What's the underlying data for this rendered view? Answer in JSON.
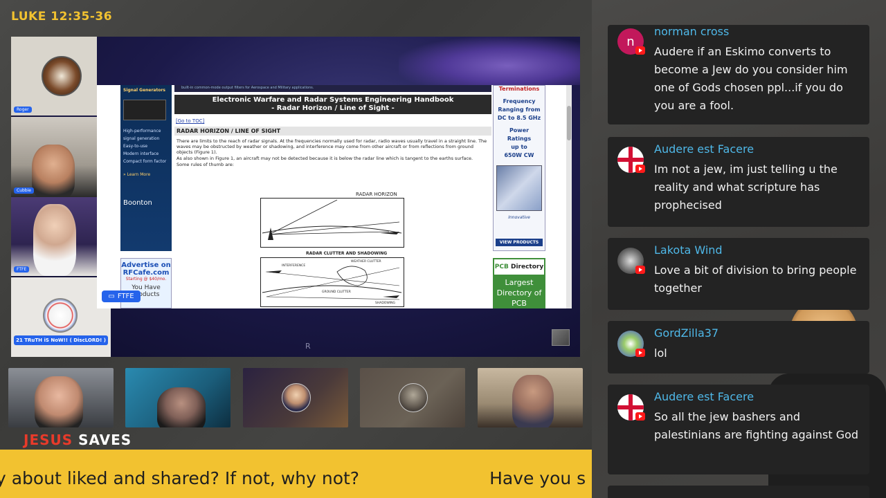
{
  "header": {
    "verse": "LUKE 12:35-36"
  },
  "stage": {
    "cameras": [
      {
        "label": "Roger"
      },
      {
        "label": "Cubbie"
      },
      {
        "label": "FTFE"
      },
      {
        "label": "21 TRuTH iS NoW!! ( DiscLORD! )"
      }
    ],
    "ftfe_chip": "FTFE",
    "watermark": "R",
    "webpage": {
      "top_strip": "built-in common-mode output filters for Aerospace and Military applications.",
      "left_ad_heading": "Signal Generators",
      "left_ad_features": [
        "High-performance signal generation",
        "Easy-to-use",
        "Modern interface",
        "Compact form factor"
      ],
      "left_ad_link": "» Learn More",
      "left_ad_brand": "Boonton",
      "title_line1": "Electronic Warfare and Radar Systems Engineering Handbook",
      "title_line2": "- Radar Horizon / Line of Sight -",
      "toc_link": "[Go to TOC]",
      "section_heading": "RADAR HORIZON / LINE OF SIGHT",
      "paragraph1": "There are limits to the reach of radar signals. At the frequencies normally used for radar, radio waves usually travel in a straight line. The waves may be obstructed by weather or shadowing, and interference may come from other aircraft or from reflections from ground objects (Figure 1).",
      "paragraph2": "As also shown in Figure 1, an aircraft may not be detected because it is below the radar line which is tangent to the earths surface.",
      "paragraph3": "Some rules of thumb are:",
      "figure1_title": "RADAR HORIZON",
      "figure2_title": "RADAR CLUTTER AND SHADOWING",
      "figure2_labels": [
        "INTERFERENCE",
        "WEATHER CLUTTER",
        "GROUND CLUTTER",
        "SHADOWING"
      ],
      "rfcafe_ad": [
        "Advertise on",
        "RFCafe.com",
        "Starting @ $40/mo.",
        "You Have Products"
      ],
      "right_ad_heading": "Terminations",
      "right_ad_freq": [
        "Frequency",
        "Ranging from",
        "DC to 8.5 GHz"
      ],
      "right_ad_power": [
        "Power",
        "Ratings",
        "up to",
        "650W CW"
      ],
      "right_ad_brand": "Innovative",
      "right_ad_button": "VIEW PRODUCTS",
      "pcb_brand_a": "PCB",
      "pcb_brand_b": "Directory",
      "pcb_body": [
        "Largest",
        "Directory of",
        "PCB"
      ]
    }
  },
  "bottom": {
    "slogan_red": "JESUS",
    "slogan_white": "SAVES",
    "ticker_text_a": "y about liked and shared? If not, why not?",
    "ticker_text_b": "Have you s"
  },
  "chat": {
    "messages": [
      {
        "author": "norman cross",
        "initial": "n",
        "text": "Audere if an Eskimo converts to become a Jew do you consider him one of Gods chosen ppl...if you do you are a fool."
      },
      {
        "author": "Audere est Facere",
        "text": "Im not a jew, im just telling u the reality and what scripture has prophecised"
      },
      {
        "author": "Lakota Wind",
        "text": "Love a bit of division to bring people together"
      },
      {
        "author": "GordZilla37",
        "text": "lol"
      },
      {
        "author": "Audere est Facere",
        "text": "So all the jew bashers and palestinians are fighting against God"
      }
    ]
  },
  "colors": {
    "accent_yellow": "#f2c230",
    "chat_name": "#4fb8e8",
    "youtube_red": "#ff1a1a",
    "chip_blue": "#2563eb"
  }
}
